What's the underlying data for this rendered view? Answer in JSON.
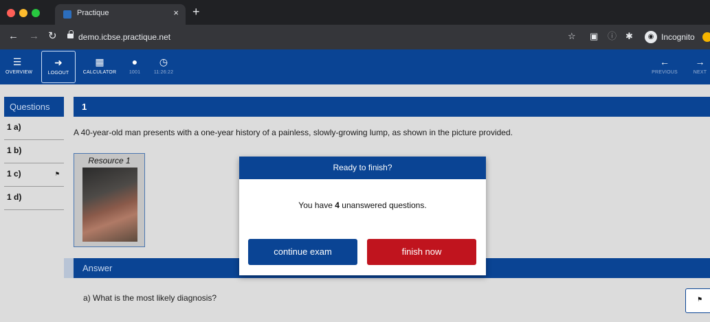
{
  "browser": {
    "tab_title": "Practique",
    "tab_close": "×",
    "new_tab": "+",
    "url": "demo.icbse.practique.net",
    "profile_label": "Incognito",
    "colors": {
      "close": "#ff5f57",
      "minimize": "#febc2e",
      "maximize": "#28c840"
    }
  },
  "toolbar": {
    "overview_label": "OVERVIEW",
    "logout_label": "LOGOUT",
    "calculator_label": "CALCULATOR",
    "user_id": "1001",
    "timer": "11:26:22",
    "previous_label": "PREVIOUS",
    "next_label": "NEXT"
  },
  "sidebar": {
    "header": "Questions",
    "items": [
      {
        "label": "1 a)",
        "flagged": false
      },
      {
        "label": "1 b)",
        "flagged": false
      },
      {
        "label": "1 c)",
        "flagged": true
      },
      {
        "label": "1 d)",
        "flagged": false
      }
    ]
  },
  "question": {
    "number": "1",
    "stem": "A 40-year-old man presents with a one-year history of a painless, slowly-growing lump, as shown in the picture provided.",
    "resource_title": "Resource 1",
    "answer_header": "Answer",
    "subquestion": "a)  What is the most likely diagnosis?"
  },
  "modal": {
    "title": "Ready to finish?",
    "msg_prefix": "You have ",
    "unanswered_count": "4",
    "msg_suffix": " unanswered questions.",
    "continue_label": "continue exam",
    "finish_label": "finish now"
  },
  "theme": {
    "primary": "#0a4494",
    "danger": "#c0141e",
    "background": "#dcdcdc"
  }
}
